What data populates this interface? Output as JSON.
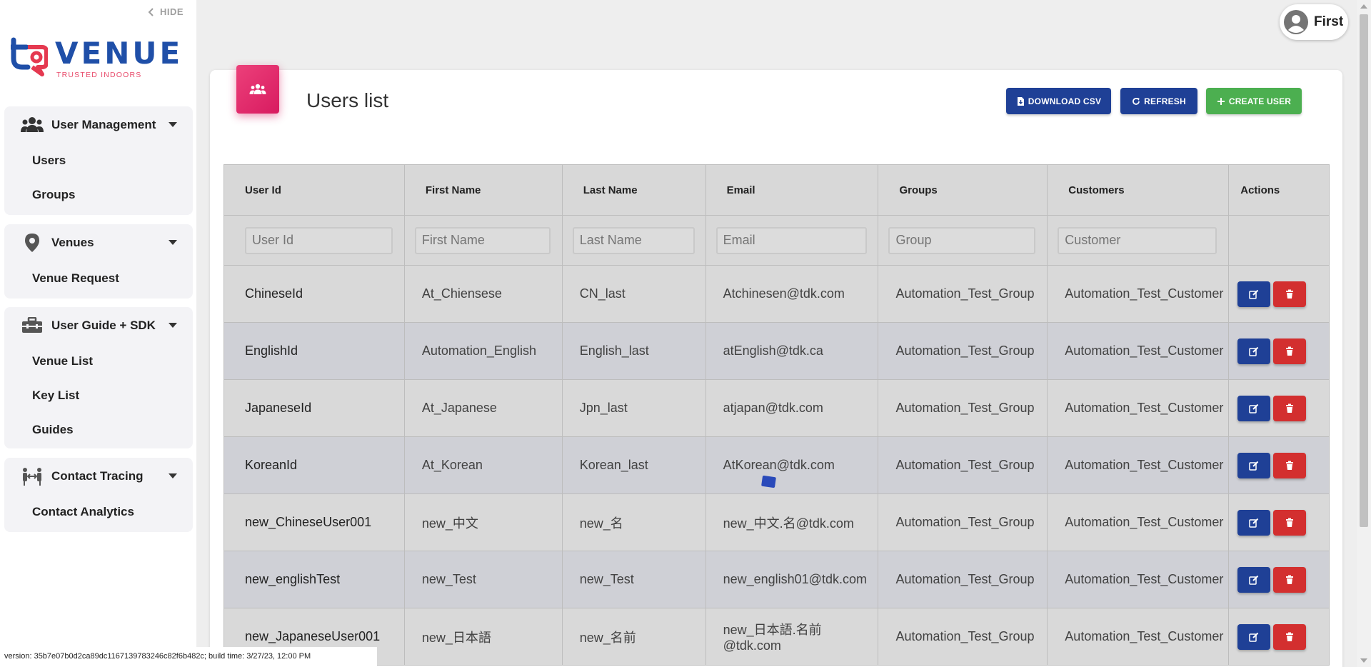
{
  "sidebar": {
    "hide_label": "HIDE",
    "logo": {
      "word": "VENUE",
      "tagline": "TRUSTED INDOORS"
    },
    "groups": [
      {
        "label": "User Management",
        "icon": "users-icon",
        "items": [
          "Users",
          "Groups"
        ]
      },
      {
        "label": "Venues",
        "icon": "map-pin-icon",
        "items": [
          "Venue Request"
        ]
      },
      {
        "label": "User Guide + SDK",
        "icon": "toolbox-icon",
        "items": [
          "Venue List",
          "Key List",
          "Guides"
        ]
      },
      {
        "label": "Contact Tracing",
        "icon": "people-arrows-icon",
        "items": [
          "Contact Analytics"
        ]
      }
    ]
  },
  "version_text": "version: 35b7e07b0d2ca89dc1167139783246c82f6b482c;    build time: 3/27/23, 12:00 PM",
  "user": {
    "name": "First"
  },
  "page": {
    "title": "Users list",
    "buttons": {
      "download": "DOWNLOAD CSV",
      "refresh": "REFRESH",
      "create": "CREATE USER"
    }
  },
  "table": {
    "headers": [
      "User Id",
      "First Name",
      "Last Name",
      "Email",
      "Groups",
      "Customers",
      "Actions"
    ],
    "filters": [
      "User Id",
      "First Name",
      "Last Name",
      "Email",
      "Group",
      "Customer"
    ],
    "rows": [
      [
        "ChineseId",
        "At_Chiensese",
        "CN_last",
        "Atchinesen@tdk.com",
        "Automation_Test_Group",
        "Automation_Test_Customer"
      ],
      [
        "EnglishId",
        "Automation_English",
        "English_last",
        "atEnglish@tdk.ca",
        "Automation_Test_Group",
        "Automation_Test_Customer"
      ],
      [
        "JapaneseId",
        "At_Japanese",
        "Jpn_last",
        "atjapan@tdk.com",
        "Automation_Test_Group",
        "Automation_Test_Customer"
      ],
      [
        "KoreanId",
        "At_Korean",
        "Korean_last",
        "AtKorean@tdk.com",
        "Automation_Test_Group",
        "Automation_Test_Customer"
      ],
      [
        "new_ChineseUser001",
        "new_中文",
        "new_名",
        "new_中文.名@tdk.com",
        "Automation_Test_Group",
        "Automation_Test_Customer"
      ],
      [
        "new_englishTest",
        "new_Test",
        "new_Test",
        "new_english01@tdk.com",
        "Automation_Test_Group",
        "Automation_Test_Customer"
      ],
      [
        "new_JapaneseUser001",
        "new_日本語",
        "new_名前",
        "new_日本語.名前@tdk.com",
        "Automation_Test_Group",
        "Automation_Test_Customer"
      ]
    ]
  },
  "colors": {
    "primary": "#1f4096",
    "success": "#4caf50",
    "danger": "#d32f2f",
    "accent": "#d81b60",
    "link": "#2f6fc6"
  }
}
